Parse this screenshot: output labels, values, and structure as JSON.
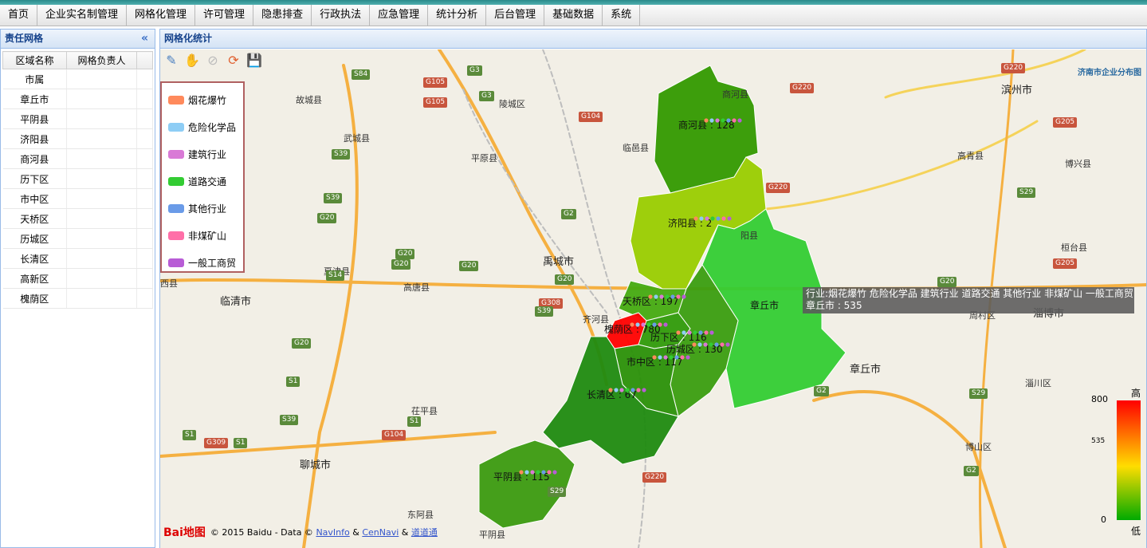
{
  "menu": [
    "首页",
    "企业实名制管理",
    "网格化管理",
    "许可管理",
    "隐患排查",
    "行政执法",
    "应急管理",
    "统计分析",
    "后台管理",
    "基础数据",
    "系统"
  ],
  "left_panel": {
    "title": "责任网格",
    "collapse_glyph": "«",
    "columns": [
      "区域名称",
      "网格负责人"
    ],
    "rows": [
      "市属",
      "章丘市",
      "平阴县",
      "济阳县",
      "商河县",
      "历下区",
      "市中区",
      "天桥区",
      "历城区",
      "长清区",
      "高新区",
      "槐荫区"
    ]
  },
  "map_panel": {
    "title": "网格化统计",
    "toolbar_icons": [
      "pencil-icon",
      "hand-icon",
      "clear-icon",
      "refresh-icon",
      "save-icon"
    ],
    "top_right_label": "济南市企业分布图",
    "legend": [
      {
        "label": "烟花爆竹",
        "color": "#ff8a5c"
      },
      {
        "label": "危险化学品",
        "color": "#8ecdf5"
      },
      {
        "label": "建筑行业",
        "color": "#d97ad6"
      },
      {
        "label": "道路交通",
        "color": "#33cc33"
      },
      {
        "label": "其他行业",
        "color": "#6a9be8"
      },
      {
        "label": "非煤矿山",
        "color": "#ff6fa8"
      },
      {
        "label": "一般工商贸",
        "color": "#b85cd6"
      }
    ],
    "tooltip": {
      "line1": "行业:烟花爆竹 危险化学品 建筑行业 道路交通 其他行业 非煤矿山 一般工商贸",
      "line2": "章丘市 : 535"
    },
    "scale": {
      "high_label": "高",
      "low_label": "低",
      "max": "800",
      "mid": "535",
      "min": "0"
    },
    "attribution": {
      "logo": "Bai地图",
      "text": "© 2015 Baidu - Data ©",
      "link1": "NavInfo",
      "amp": "&",
      "link2": "CenNavi",
      "amp2": "&",
      "link3": "道道通"
    },
    "regions": [
      {
        "name": "商河县",
        "value": "商河县 : 128",
        "color": "#339900"
      },
      {
        "name": "济阳县",
        "value": "济阳县 : 2",
        "color": "#99cc00"
      },
      {
        "name": "章丘市",
        "value": "章丘市",
        "color": "#33cc33"
      },
      {
        "name": "天桥区",
        "value": "天桥区 : 197",
        "color": "#44aa11"
      },
      {
        "name": "槐荫区",
        "value": "槐荫区 : 780",
        "color": "#ff0000"
      },
      {
        "name": "历下区",
        "value": "历下区 : 116",
        "color": "#2f9a0a"
      },
      {
        "name": "历城区",
        "value": "历城区 : 130",
        "color": "#3a9d10"
      },
      {
        "name": "市中区",
        "value": "市中区 : 117",
        "color": "#2a9008"
      },
      {
        "name": "长清区",
        "value": "长清区 : 67",
        "color": "#1f8a10"
      },
      {
        "name": "平阴县",
        "value": "平阴县 : 115",
        "color": "#3b9a10"
      }
    ],
    "places": [
      "滨州市",
      "故城县",
      "陵城区",
      "商河县",
      "武城县",
      "临邑县",
      "平原县",
      "博兴县",
      "高青县",
      "桓台县",
      "夏津县",
      "禹城市",
      "高唐县",
      "齐河县",
      "临清市",
      "淄博市",
      "周村区",
      "章丘市",
      "淄川区",
      "茌平县",
      "聊城市",
      "博山区",
      "东阿县",
      "平阴县",
      "西县",
      "阳县"
    ],
    "roads": [
      "S84",
      "G105",
      "G3",
      "G105",
      "G3",
      "G104",
      "G220",
      "G220",
      "G205",
      "S39",
      "S39",
      "G20",
      "G20",
      "G2",
      "G220",
      "S29",
      "G205",
      "S14",
      "G20",
      "G20",
      "G20",
      "G308",
      "G20",
      "G20",
      "S39",
      "S1",
      "G2",
      "S29",
      "S39",
      "S1",
      "S1",
      "G309",
      "S1",
      "G104",
      "G220",
      "S29",
      "G2"
    ]
  }
}
